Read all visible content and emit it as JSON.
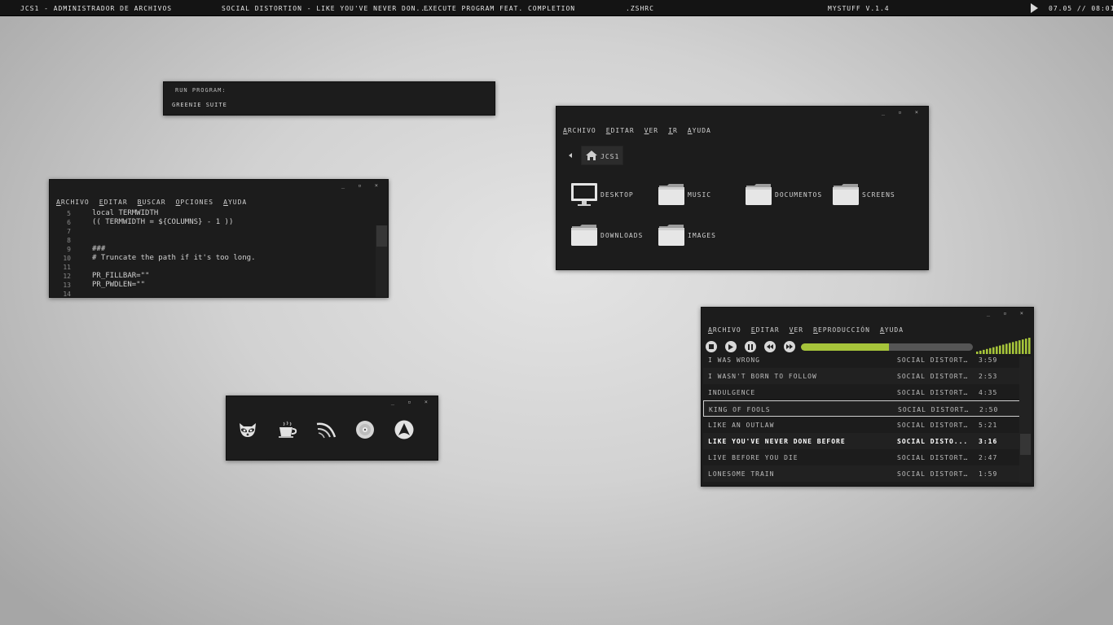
{
  "topbar": {
    "tasks": [
      "jcs1 - administrador de archivos",
      "Social Distortion - Like You've Never Don...",
      "execute program feat. completion",
      ".zshrc",
      "mystuff v.1.4"
    ],
    "clock": "07.05 // 08:01"
  },
  "run_dialog": {
    "label": "run program:",
    "value": "greenie suite"
  },
  "editor": {
    "menu": [
      "Archivo",
      "Editar",
      "Buscar",
      "Opciones",
      "Ayuda"
    ],
    "lines": [
      {
        "n": "5",
        "text": "local TERMWIDTH"
      },
      {
        "n": "6",
        "text": "(( TERMWIDTH = ${COLUMNS} - 1 ))"
      },
      {
        "n": "7",
        "text": ""
      },
      {
        "n": "8",
        "text": ""
      },
      {
        "n": "9",
        "text": "###"
      },
      {
        "n": "10",
        "text": "# Truncate the path if it's too long."
      },
      {
        "n": "11",
        "text": ""
      },
      {
        "n": "12",
        "text": "PR_FILLBAR=\"\""
      },
      {
        "n": "13",
        "text": "PR_PWDLEN=\"\""
      },
      {
        "n": "14",
        "text": ""
      }
    ]
  },
  "dock": {
    "icons": [
      "raccoon-icon",
      "coffee-cup-icon",
      "network-swoosh-icon",
      "disc-icon",
      "arch-logo-icon"
    ]
  },
  "file_manager": {
    "menu": [
      "Archivo",
      "Editar",
      "Ver",
      "Ir",
      "Ayuda"
    ],
    "breadcrumb": "jcs1",
    "items": [
      {
        "label": "desktop",
        "icon": "monitor-icon"
      },
      {
        "label": "music",
        "icon": "folder-icon"
      },
      {
        "label": "documentos",
        "icon": "folder-icon"
      },
      {
        "label": "screens",
        "icon": "folder-icon"
      },
      {
        "label": "downloads",
        "icon": "folder-icon"
      },
      {
        "label": "images",
        "icon": "folder-icon"
      }
    ]
  },
  "player": {
    "menu": [
      "Archivo",
      "Editar",
      "Ver",
      "Reproducción",
      "Ayuda"
    ],
    "progress": 0.51,
    "accent": "#a6c43a",
    "tracks": [
      {
        "title": "I was wrong",
        "artist": "Social Distortion",
        "duration": "3:59"
      },
      {
        "title": "I wasn't born to follow",
        "artist": "Social Distortion",
        "duration": "2:53"
      },
      {
        "title": "Indulgence",
        "artist": "Social Distortion",
        "duration": "4:35"
      },
      {
        "title": "King of fools",
        "artist": "Social Distortion",
        "duration": "2:50"
      },
      {
        "title": "Like an outlaw",
        "artist": "Social Distortion",
        "duration": "5:21"
      },
      {
        "title": "Like you've never done before",
        "artist": "Social Disto...",
        "duration": "3:16"
      },
      {
        "title": "Live before you die",
        "artist": "Social Distortion",
        "duration": "2:47"
      },
      {
        "title": "Lonesome train",
        "artist": "Social Distortion",
        "duration": "1:59"
      }
    ]
  }
}
